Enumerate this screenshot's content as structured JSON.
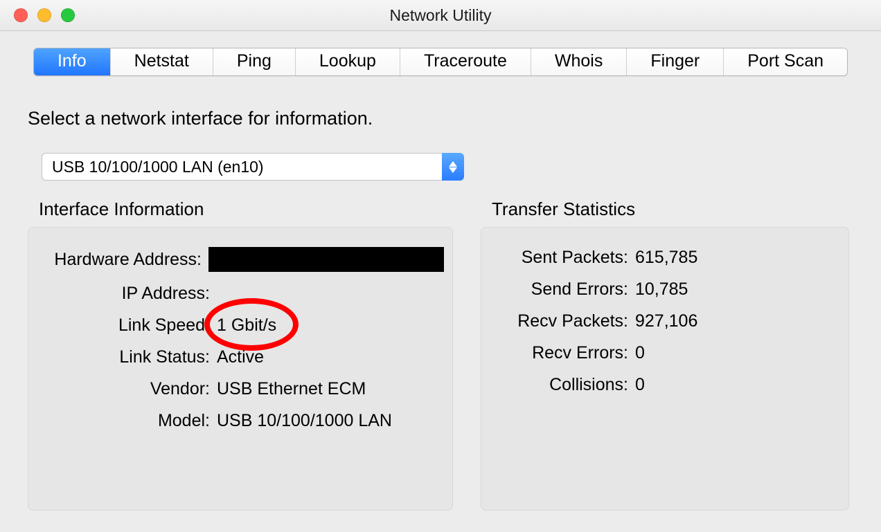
{
  "window": {
    "title": "Network Utility"
  },
  "tabs": {
    "items": [
      {
        "label": "Info",
        "selected": true
      },
      {
        "label": "Netstat",
        "selected": false
      },
      {
        "label": "Ping",
        "selected": false
      },
      {
        "label": "Lookup",
        "selected": false
      },
      {
        "label": "Traceroute",
        "selected": false
      },
      {
        "label": "Whois",
        "selected": false
      },
      {
        "label": "Finger",
        "selected": false
      },
      {
        "label": "Port Scan",
        "selected": false
      }
    ]
  },
  "prompt": "Select a network interface for information.",
  "interface_selector": {
    "selected": "USB 10/100/1000 LAN (en10)"
  },
  "sections": {
    "interface_info": {
      "title": "Interface Information",
      "labels": {
        "hardware_address": "Hardware Address:",
        "ip_address": "IP Address:",
        "link_speed": "Link Speed:",
        "link_status": "Link Status:",
        "vendor": "Vendor:",
        "model": "Model:"
      },
      "values": {
        "hardware_address": "",
        "ip_address": "",
        "link_speed": "1 Gbit/s",
        "link_status": "Active",
        "vendor": "USB Ethernet ECM",
        "model": "USB 10/100/1000 LAN"
      }
    },
    "transfer_stats": {
      "title": "Transfer Statistics",
      "labels": {
        "sent_packets": "Sent Packets:",
        "send_errors": "Send Errors:",
        "recv_packets": "Recv Packets:",
        "recv_errors": "Recv Errors:",
        "collisions": "Collisions:"
      },
      "values": {
        "sent_packets": "615,785",
        "send_errors": "10,785",
        "recv_packets": "927,106",
        "recv_errors": "0",
        "collisions": "0"
      }
    }
  },
  "annotations": {
    "circled_field": "link_speed"
  }
}
